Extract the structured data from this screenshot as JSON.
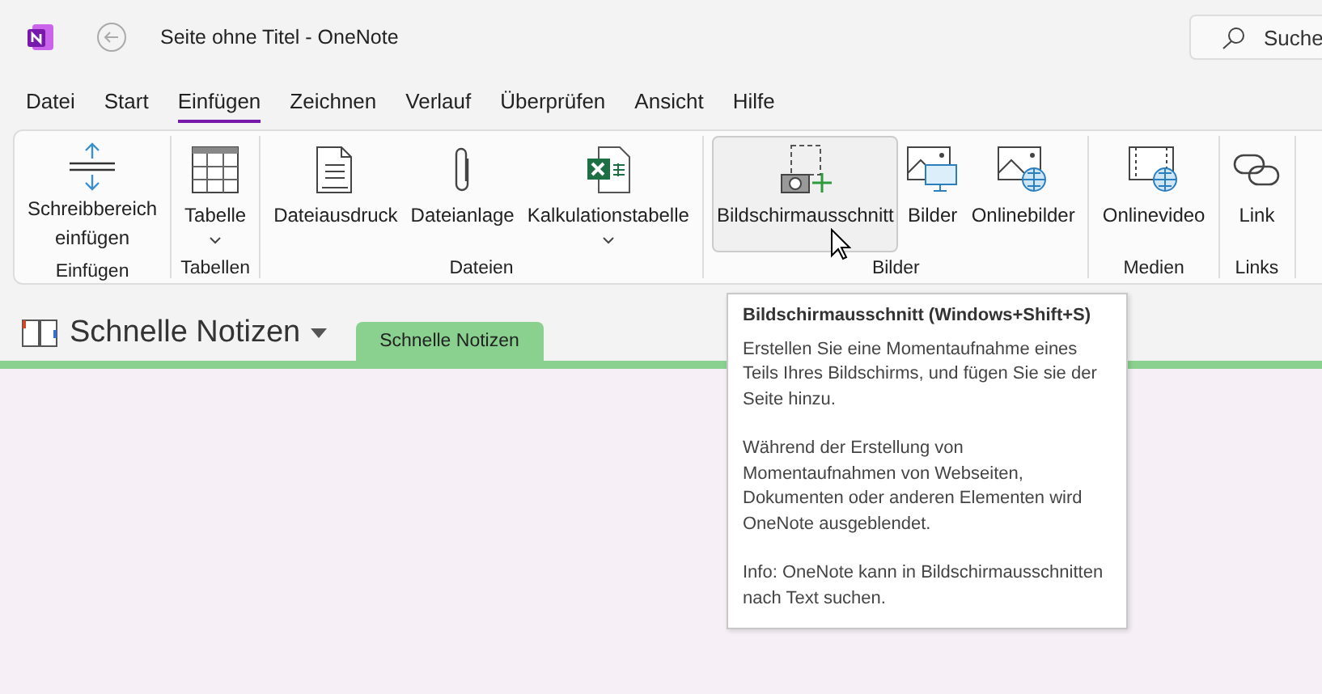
{
  "window": {
    "title": "Seite ohne Titel  -  OneNote"
  },
  "search": {
    "placeholder": "Suche"
  },
  "menu_tabs": [
    {
      "label": "Datei",
      "selected": false
    },
    {
      "label": "Start",
      "selected": false
    },
    {
      "label": "Einfügen",
      "selected": true
    },
    {
      "label": "Zeichnen",
      "selected": false
    },
    {
      "label": "Verlauf",
      "selected": false
    },
    {
      "label": "Überprüfen",
      "selected": false
    },
    {
      "label": "Ansicht",
      "selected": false
    },
    {
      "label": "Hilfe",
      "selected": false
    }
  ],
  "ribbon": {
    "groups": [
      {
        "label": "Einfügen",
        "buttons": [
          {
            "kind": "space",
            "label": "Schreibbereich",
            "label2": "einfügen",
            "dropdown": false,
            "hovered": false
          }
        ]
      },
      {
        "label": "Tabellen",
        "buttons": [
          {
            "kind": "table",
            "label": "Tabelle",
            "dropdown": true,
            "hovered": false
          }
        ]
      },
      {
        "label": "Dateien",
        "buttons": [
          {
            "kind": "printout",
            "label": "Dateiausdruck",
            "dropdown": false,
            "hovered": false
          },
          {
            "kind": "attach",
            "label": "Dateianlage",
            "dropdown": false,
            "hovered": false
          },
          {
            "kind": "spreadsheet",
            "label": "Kalkulationstabelle",
            "dropdown": true,
            "hovered": false
          }
        ]
      },
      {
        "label": "Bilder",
        "buttons": [
          {
            "kind": "screenshot",
            "label": "Bildschirmausschnitt",
            "dropdown": false,
            "hovered": true
          },
          {
            "kind": "pictures",
            "label": "Bilder",
            "dropdown": false,
            "hovered": false
          },
          {
            "kind": "onlinepictures",
            "label": "Onlinebilder",
            "dropdown": false,
            "hovered": false
          }
        ]
      },
      {
        "label": "Medien",
        "buttons": [
          {
            "kind": "video",
            "label": "Onlinevideo",
            "dropdown": false,
            "hovered": false
          }
        ]
      },
      {
        "label": "Links",
        "buttons": [
          {
            "kind": "link",
            "label": "Link",
            "dropdown": false,
            "hovered": false
          }
        ]
      }
    ]
  },
  "section_bar": {
    "notebook": "Schnelle Notizen",
    "tabs": [
      {
        "label": "Schnelle Notizen",
        "selected": true,
        "color": "#8ad18f"
      }
    ]
  },
  "tooltip": {
    "title": "Bildschirmausschnitt (Windows+Shift+S)",
    "paragraphs": [
      "Erstellen Sie eine Momentaufnahme eines Teils Ihres Bildschirms, und fügen Sie sie der Seite hinzu.",
      "Während der Erstellung von Momentaufnahmen von Webseiten, Dokumenten oder anderen Elementen wird OneNote ausgeblendet.",
      "Info: OneNote kann in Bildschirmausschnitten nach Text suchen."
    ]
  }
}
